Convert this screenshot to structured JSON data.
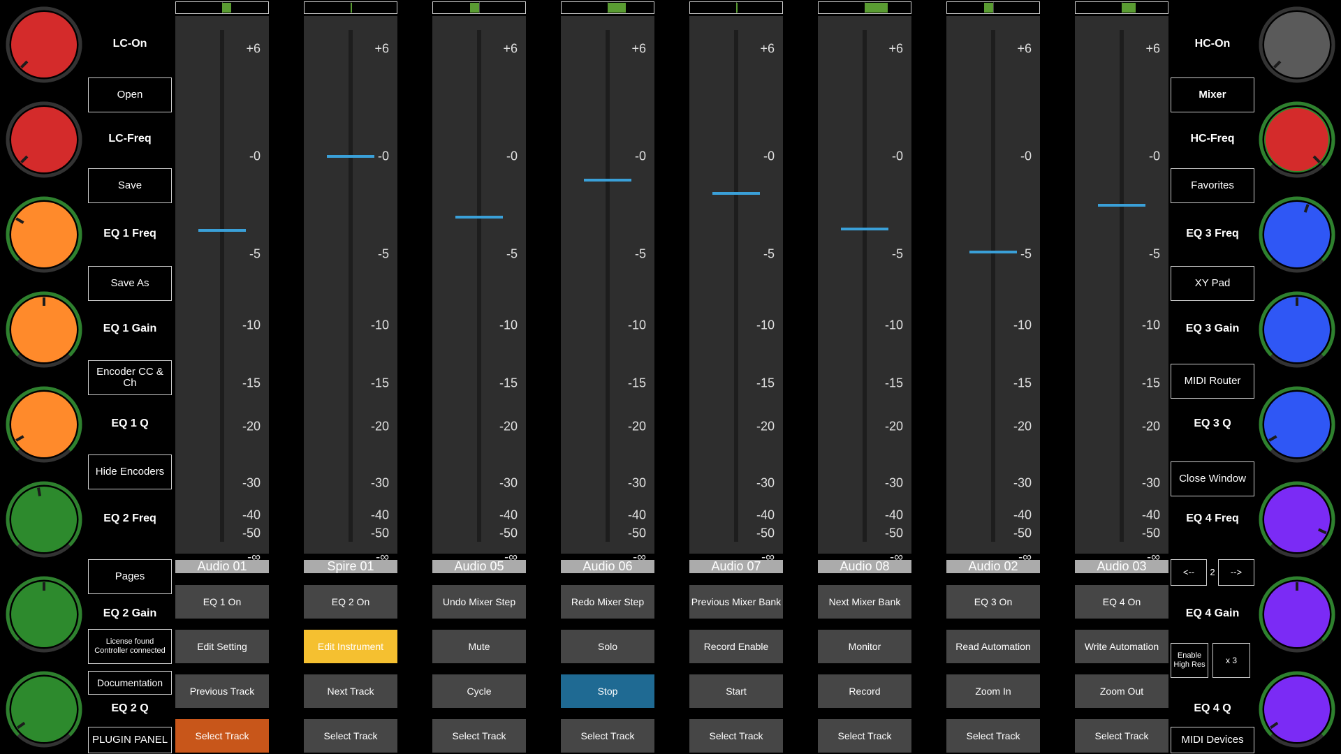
{
  "left_knobs": [
    {
      "label": "LC-On",
      "color": "#d42b2b",
      "ring": "#d42b2b",
      "arc": "#333333",
      "angle": 225
    },
    {
      "label": "LC-Freq",
      "color": "#d42b2b",
      "ring": "#d42b2b",
      "arc": "#333333",
      "angle": 225
    },
    {
      "label": "EQ 1 Freq",
      "color": "#ff8a2b",
      "ring": "#ff8a2b",
      "arc": "#2d8a2d",
      "angle": 300
    },
    {
      "label": "EQ 1 Gain",
      "color": "#ff8a2b",
      "ring": "#ff8a2b",
      "arc": "#2d8a2d",
      "angle": 0
    },
    {
      "label": "EQ 1 Q",
      "color": "#ff8a2b",
      "ring": "#ff8a2b",
      "arc": "#2d8a2d",
      "angle": 240
    },
    {
      "label": "EQ 2 Freq",
      "color": "#2d8a2d",
      "ring": "#2d8a2d",
      "arc": "#2d8a2d",
      "angle": 350
    },
    {
      "label": "EQ 2 Gain",
      "color": "#2d8a2d",
      "ring": "#2d8a2d",
      "arc": "#2d8a2d",
      "angle": 0
    },
    {
      "label": "EQ 2 Q",
      "color": "#2d8a2d",
      "ring": "#2d8a2d",
      "arc": "#2d8a2d",
      "angle": 235
    }
  ],
  "right_knobs": [
    {
      "label": "HC-On",
      "color": "#5a5a5a",
      "ring": "#5a5a5a",
      "arc": "#333333",
      "angle": 225
    },
    {
      "label": "HC-Freq",
      "color": "#d42b2b",
      "ring": "#2d8a2d",
      "arc": "#2d8a2d",
      "angle": 135
    },
    {
      "label": "EQ 3 Freq",
      "color": "#2f57f5",
      "ring": "#2f57f5",
      "arc": "#2d8a2d",
      "angle": 20
    },
    {
      "label": "EQ 3 Gain",
      "color": "#2f57f5",
      "ring": "#2f57f5",
      "arc": "#2d8a2d",
      "angle": 0
    },
    {
      "label": "EQ 3 Q",
      "color": "#2f57f5",
      "ring": "#2f57f5",
      "arc": "#2d8a2d",
      "angle": 240
    },
    {
      "label": "EQ 4 Freq",
      "color": "#7b2bf5",
      "ring": "#7b2bf5",
      "arc": "#2d8a2d",
      "angle": 115
    },
    {
      "label": "EQ 4 Gain",
      "color": "#7b2bf5",
      "ring": "#7b2bf5",
      "arc": "#2d8a2d",
      "angle": 0
    },
    {
      "label": "EQ 4 Q",
      "color": "#7b2bf5",
      "ring": "#7b2bf5",
      "arc": "#2d8a2d",
      "angle": 235
    }
  ],
  "left_buttons": {
    "open": "Open",
    "save": "Save",
    "save_as": "Save As",
    "encoder_cc": "Encoder CC & Ch",
    "hide_encoders": "Hide Encoders",
    "pages": "Pages",
    "license_status": "License found Controller connected",
    "documentation": "Documentation",
    "plugin_panel": "PLUGIN PANEL"
  },
  "right_buttons": {
    "mixer": "Mixer",
    "favorites": "Favorites",
    "xy_pad": "XY Pad",
    "midi_router": "MIDI Router",
    "close_window": "Close Window",
    "page_prev": "<--",
    "page_number": "2",
    "page_next": "-->",
    "enable_high_res": "Enable High Res",
    "multiplier": "x 3",
    "midi_devices": "MIDI Devices"
  },
  "fader_scale": [
    "+6",
    "-0",
    "-5",
    "-10",
    "-15",
    "-20",
    "-30",
    "-40",
    "-50",
    "-∞"
  ],
  "fader_colors": {
    "handle": "#3aa0d8",
    "meter": "#5a9c32",
    "highlight_yellow": "#f5c030",
    "highlight_orange": "#c8561a",
    "highlight_blue": "#1f6a93"
  },
  "tracks": [
    {
      "name": "Audio 01",
      "level": -3.8,
      "meter": [
        0.5,
        0.6
      ],
      "buttons": [
        {
          "label": "EQ 1 On"
        },
        {
          "label": "Edit Setting"
        },
        {
          "label": "Previous Track"
        },
        {
          "label": "Select Track",
          "active": "orange"
        }
      ]
    },
    {
      "name": "Spire 01",
      "level": 0.0,
      "meter": [
        0.5,
        0.5
      ],
      "buttons": [
        {
          "label": "EQ 2 On"
        },
        {
          "label": "Edit Instrument",
          "active": "yellow"
        },
        {
          "label": "Next Track"
        },
        {
          "label": "Select Track"
        }
      ]
    },
    {
      "name": "Audio 05",
      "level": -3.1,
      "meter": [
        0.4,
        0.5
      ],
      "buttons": [
        {
          "label": "Undo Mixer Step"
        },
        {
          "label": "Mute"
        },
        {
          "label": "Cycle"
        },
        {
          "label": "Select Track"
        }
      ]
    },
    {
      "name": "Audio 06",
      "level": -1.2,
      "meter": [
        0.5,
        0.7
      ],
      "buttons": [
        {
          "label": "Redo Mixer Step"
        },
        {
          "label": "Solo"
        },
        {
          "label": "Stop",
          "active": "blue"
        },
        {
          "label": "Select Track"
        }
      ]
    },
    {
      "name": "Audio 07",
      "level": -1.9,
      "meter": [
        0.5,
        0.5
      ],
      "buttons": [
        {
          "label": "Previous Mixer Bank"
        },
        {
          "label": "Record Enable"
        },
        {
          "label": "Start"
        },
        {
          "label": "Select Track"
        }
      ]
    },
    {
      "name": "Audio 08",
      "level": -3.7,
      "meter": [
        0.5,
        0.75
      ],
      "buttons": [
        {
          "label": "Next Mixer Bank"
        },
        {
          "label": "Monitor"
        },
        {
          "label": "Record"
        },
        {
          "label": "Select Track"
        }
      ]
    },
    {
      "name": "Audio 02",
      "level": -4.9,
      "meter": [
        0.4,
        0.5
      ],
      "buttons": [
        {
          "label": "EQ 3 On"
        },
        {
          "label": "Read Automation"
        },
        {
          "label": "Zoom In"
        },
        {
          "label": "Select Track"
        }
      ]
    },
    {
      "name": "Audio 03",
      "level": -2.5,
      "meter": [
        0.5,
        0.65
      ],
      "buttons": [
        {
          "label": "EQ 4 On"
        },
        {
          "label": "Write Automation"
        },
        {
          "label": "Zoom Out"
        },
        {
          "label": "Select Track"
        }
      ]
    }
  ]
}
